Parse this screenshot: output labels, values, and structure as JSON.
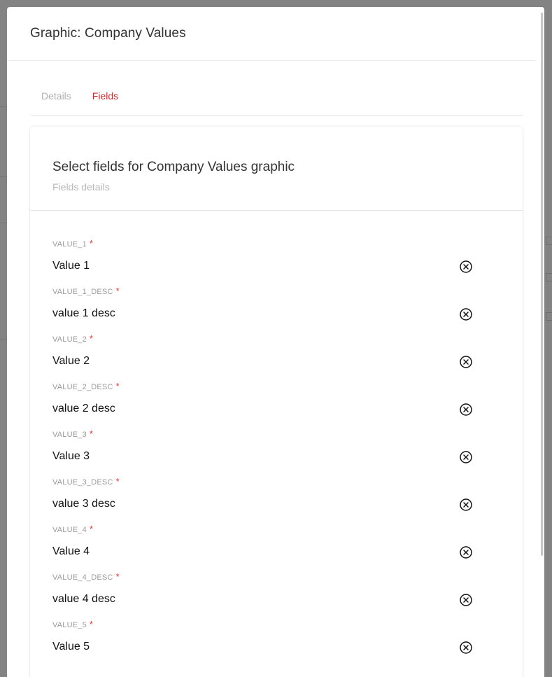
{
  "modal": {
    "title": "Graphic: Company Values"
  },
  "tabs": [
    {
      "label": "Details",
      "active": false
    },
    {
      "label": "Fields",
      "active": true
    }
  ],
  "card": {
    "title": "Select fields for Company Values graphic",
    "subtitle": "Fields details"
  },
  "fields": [
    {
      "label": "VALUE_1",
      "value": "Value 1",
      "required": "*"
    },
    {
      "label": "VALUE_1_DESC",
      "value": "value 1 desc",
      "required": "*"
    },
    {
      "label": "VALUE_2",
      "value": "Value 2",
      "required": "*"
    },
    {
      "label": "VALUE_2_DESC",
      "value": "value 2 desc",
      "required": "*"
    },
    {
      "label": "VALUE_3",
      "value": "Value 3",
      "required": "*"
    },
    {
      "label": "VALUE_3_DESC",
      "value": "value 3 desc",
      "required": "*"
    },
    {
      "label": "VALUE_4",
      "value": "Value 4",
      "required": "*"
    },
    {
      "label": "VALUE_4_DESC",
      "value": "value 4 desc",
      "required": "*"
    },
    {
      "label": "VALUE_5",
      "value": "Value 5",
      "required": "*"
    }
  ],
  "icons": {
    "clear": "circle-x-icon"
  },
  "colors": {
    "accent": "#c5282f",
    "required": "#d93939",
    "overlay": "#7f7f7f"
  }
}
